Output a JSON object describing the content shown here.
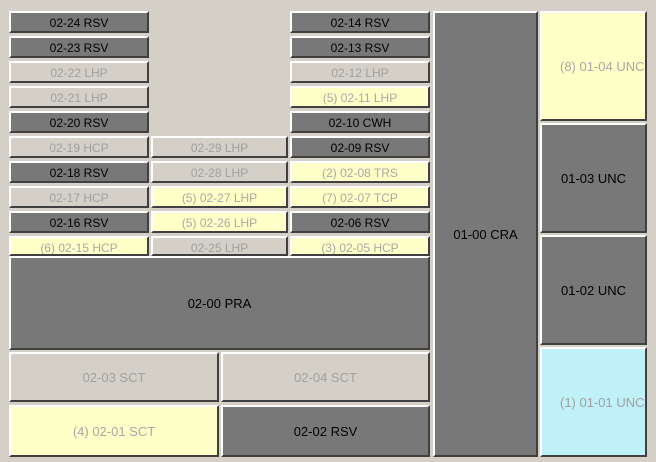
{
  "colors": {
    "background": "#d4d0c8",
    "reserved": "#787878",
    "highlight_yellow": "#ffffc8",
    "highlight_cyan": "#c0f0f8",
    "dim_text": "#a0a0a0"
  },
  "column1": [
    "02-24 RSV",
    "02-23 RSV",
    "02-22 LHP",
    "02-21 LHP",
    "02-20 RSV",
    "02-19 HCP",
    "02-18 RSV",
    "02-17 HCP",
    "02-16 RSV",
    "(6) 02-15 HCP"
  ],
  "column2": [
    "02-29 LHP",
    "02-28 LHP",
    "(5) 02-27 LHP",
    "(5) 02-26 LHP",
    "02-25 LHP"
  ],
  "column3": [
    "02-14 RSV",
    "02-13 RSV",
    "02-12 LHP",
    "(5) 02-11 LHP",
    "02-10 CWH",
    "02-09 RSV",
    "(2) 02-08 TRS",
    "(7) 02-07 TCP",
    "02-06 RSV",
    "(3) 02-05 HCP"
  ],
  "pra": "02-00 PRA",
  "sct": {
    "s03": "02-03 SCT",
    "s04": "02-04 SCT",
    "s01": "(4) 02-01 SCT",
    "s02": "02-02 RSV"
  },
  "cra": "01-00 CRA",
  "unc": {
    "u04": "(8) 01-04 UNC",
    "u03": "01-03 UNC",
    "u02": "01-02 UNC",
    "u01": "(1) 01-01 UNC"
  }
}
